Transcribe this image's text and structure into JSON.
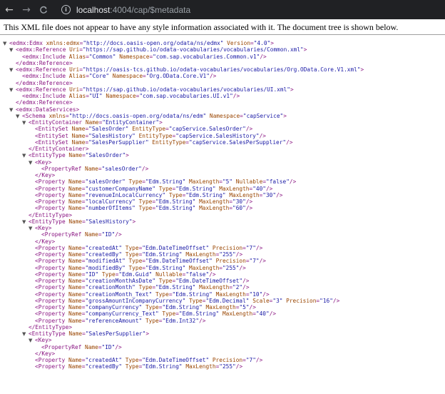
{
  "browser": {
    "back_icon": "←",
    "forward_icon": "→",
    "reload_icon": "C",
    "info_icon": "i",
    "url_host": "localhost",
    "url_rest": ":4004/cap/$metadata"
  },
  "notice": "This XML file does not appear to have any style information associated with it. The document tree is shown below.",
  "lines": [
    {
      "i": 0,
      "t": "▼",
      "x": "<edmx:Edmx xmlns:edmx=\"http://docs.oasis-open.org/odata/ns/edmx\" Version=\"4.0\">"
    },
    {
      "i": 1,
      "t": "▼",
      "x": "<edmx:Reference Uri=\"https://sap.github.io/odata-vocabularies/vocabularies/Common.xml\">"
    },
    {
      "i": 3,
      "t": "",
      "x": "<edmx:Include Alias=\"Common\" Namespace=\"com.sap.vocabularies.Common.v1\"/>"
    },
    {
      "i": 2,
      "t": "",
      "x": "</edmx:Reference>"
    },
    {
      "i": 1,
      "t": "▼",
      "x": "<edmx:Reference Uri=\"https://oasis-tcs.github.io/odata-vocabularies/vocabularies/Org.OData.Core.V1.xml\">"
    },
    {
      "i": 3,
      "t": "",
      "x": "<edmx:Include Alias=\"Core\" Namespace=\"Org.OData.Core.V1\"/>"
    },
    {
      "i": 2,
      "t": "",
      "x": "</edmx:Reference>"
    },
    {
      "i": 1,
      "t": "▼",
      "x": "<edmx:Reference Uri=\"https://sap.github.io/odata-vocabularies/vocabularies/UI.xml\">"
    },
    {
      "i": 3,
      "t": "",
      "x": "<edmx:Include Alias=\"UI\" Namespace=\"com.sap.vocabularies.UI.v1\"/>"
    },
    {
      "i": 2,
      "t": "",
      "x": "</edmx:Reference>"
    },
    {
      "i": 1,
      "t": "▼",
      "x": "<edmx:DataServices>"
    },
    {
      "i": 2,
      "t": "▼",
      "x": "<Schema xmlns=\"http://docs.oasis-open.org/odata/ns/edm\" Namespace=\"capService\">"
    },
    {
      "i": 3,
      "t": "▼",
      "x": "<EntityContainer Name=\"EntityContainer\">"
    },
    {
      "i": 5,
      "t": "",
      "x": "<EntitySet Name=\"SalesOrder\" EntityType=\"capService.SalesOrder\"/>"
    },
    {
      "i": 5,
      "t": "",
      "x": "<EntitySet Name=\"SalesHistory\" EntityType=\"capService.SalesHistory\"/>"
    },
    {
      "i": 5,
      "t": "",
      "x": "<EntitySet Name=\"SalesPerSupplier\" EntityType=\"capService.SalesPerSupplier\"/>"
    },
    {
      "i": 4,
      "t": "",
      "x": "</EntityContainer>"
    },
    {
      "i": 3,
      "t": "▼",
      "x": "<EntityType Name=\"SalesOrder\">"
    },
    {
      "i": 4,
      "t": "▼",
      "x": "<Key>"
    },
    {
      "i": 6,
      "t": "",
      "x": "<PropertyRef Name=\"salesOrder\"/>"
    },
    {
      "i": 5,
      "t": "",
      "x": "</Key>"
    },
    {
      "i": 5,
      "t": "",
      "x": "<Property Name=\"salesOrder\" Type=\"Edm.String\" MaxLength=\"5\" Nullable=\"false\"/>"
    },
    {
      "i": 5,
      "t": "",
      "x": "<Property Name=\"customerCompanyName\" Type=\"Edm.String\" MaxLength=\"40\"/>"
    },
    {
      "i": 5,
      "t": "",
      "x": "<Property Name=\"revenueInLocalCurrency\" Type=\"Edm.String\" MaxLength=\"30\"/>"
    },
    {
      "i": 5,
      "t": "",
      "x": "<Property Name=\"localCurrency\" Type=\"Edm.String\" MaxLength=\"30\"/>"
    },
    {
      "i": 5,
      "t": "",
      "x": "<Property Name=\"numberOfItems\" Type=\"Edm.String\" MaxLength=\"60\"/>"
    },
    {
      "i": 4,
      "t": "",
      "x": "</EntityType>"
    },
    {
      "i": 3,
      "t": "▼",
      "x": "<EntityType Name=\"SalesHistory\">"
    },
    {
      "i": 4,
      "t": "▼",
      "x": "<Key>"
    },
    {
      "i": 6,
      "t": "",
      "x": "<PropertyRef Name=\"ID\"/>"
    },
    {
      "i": 5,
      "t": "",
      "x": "</Key>"
    },
    {
      "i": 5,
      "t": "",
      "x": "<Property Name=\"createdAt\" Type=\"Edm.DateTimeOffset\" Precision=\"7\"/>"
    },
    {
      "i": 5,
      "t": "",
      "x": "<Property Name=\"createdBy\" Type=\"Edm.String\" MaxLength=\"255\"/>"
    },
    {
      "i": 5,
      "t": "",
      "x": "<Property Name=\"modifiedAt\" Type=\"Edm.DateTimeOffset\" Precision=\"7\"/>"
    },
    {
      "i": 5,
      "t": "",
      "x": "<Property Name=\"modifiedBy\" Type=\"Edm.String\" MaxLength=\"255\"/>"
    },
    {
      "i": 5,
      "t": "",
      "x": "<Property Name=\"ID\" Type=\"Edm.Guid\" Nullable=\"false\"/>"
    },
    {
      "i": 5,
      "t": "",
      "x": "<Property Name=\"creationMonthAsDate\" Type=\"Edm.DateTimeOffset\"/>"
    },
    {
      "i": 5,
      "t": "",
      "x": "<Property Name=\"creationMonth\" Type=\"Edm.String\" MaxLength=\"2\"/>"
    },
    {
      "i": 5,
      "t": "",
      "x": "<Property Name=\"creationMonth_Text\" Type=\"Edm.String\" MaxLength=\"10\"/>"
    },
    {
      "i": 5,
      "t": "",
      "x": "<Property Name=\"grossAmountInCompanyCurrency\" Type=\"Edm.Decimal\" Scale=\"3\" Precision=\"16\"/>"
    },
    {
      "i": 5,
      "t": "",
      "x": "<Property Name=\"companyCurrency\" Type=\"Edm.String\" MaxLength=\"5\"/>"
    },
    {
      "i": 5,
      "t": "",
      "x": "<Property Name=\"companyCurrency_Text\" Type=\"Edm.String\" MaxLength=\"40\"/>"
    },
    {
      "i": 5,
      "t": "",
      "x": "<Property Name=\"referenceAmount\" Type=\"Edm.Int32\"/>"
    },
    {
      "i": 4,
      "t": "",
      "x": "</EntityType>"
    },
    {
      "i": 3,
      "t": "▼",
      "x": "<EntityType Name=\"SalesPerSupplier\">"
    },
    {
      "i": 4,
      "t": "▼",
      "x": "<Key>"
    },
    {
      "i": 6,
      "t": "",
      "x": "<PropertyRef Name=\"ID\"/>"
    },
    {
      "i": 5,
      "t": "",
      "x": "</Key>"
    },
    {
      "i": 5,
      "t": "",
      "x": "<Property Name=\"createdAt\" Type=\"Edm.DateTimeOffset\" Precision=\"7\"/>"
    },
    {
      "i": 5,
      "t": "",
      "x": "<Property Name=\"createdBy\" Type=\"Edm.String\" MaxLength=\"255\"/>"
    }
  ]
}
